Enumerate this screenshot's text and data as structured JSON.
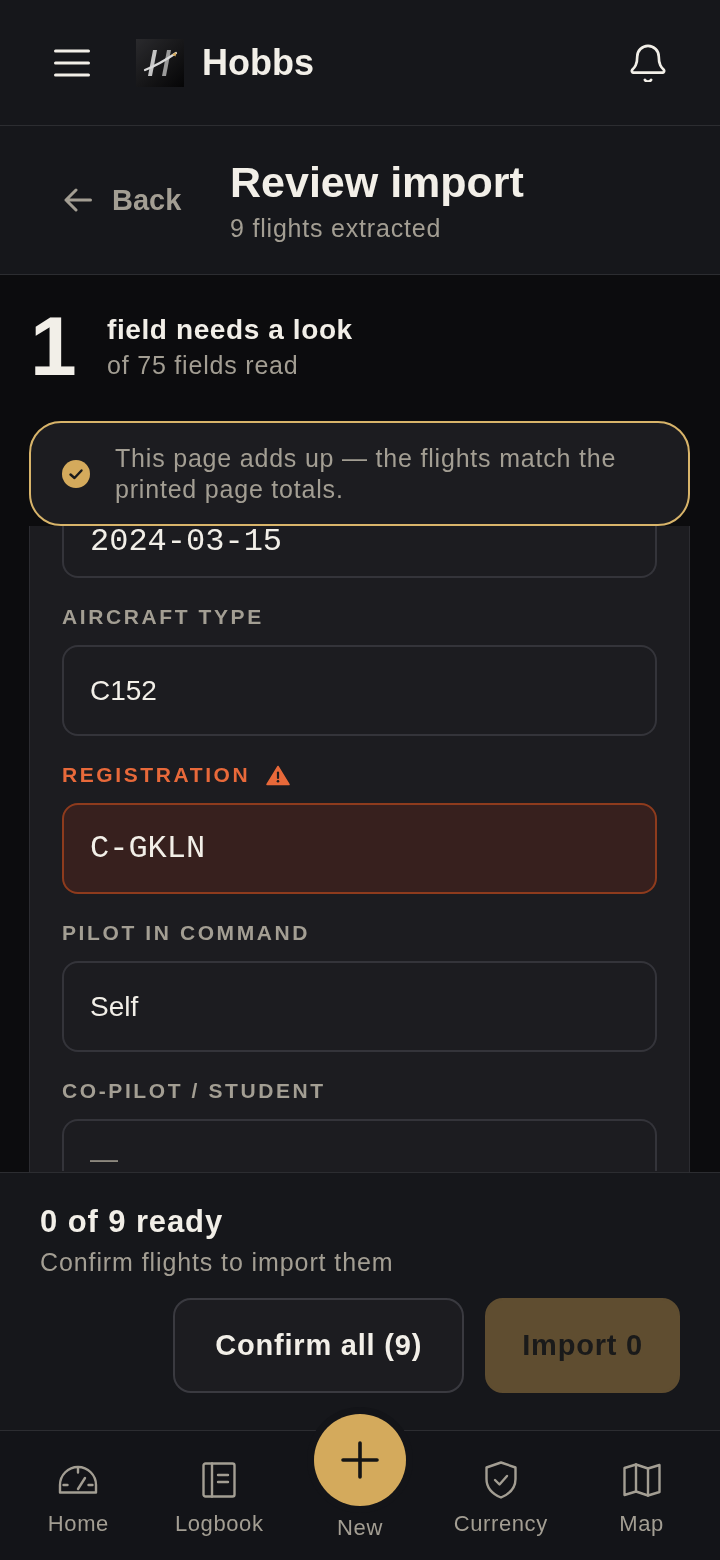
{
  "app_bar": {
    "title": "Hobbs"
  },
  "page_header": {
    "back_label": "Back",
    "title": "Review import",
    "subtitle": "9 flights extracted"
  },
  "summary": {
    "count": "1",
    "headline": "field needs a look",
    "detail": "of 75 fields read"
  },
  "banner": {
    "message": "This page adds up — the flights match the printed page totals."
  },
  "flight_card": {
    "fields": [
      {
        "value": "2024-03-15",
        "kind": "code",
        "flagged": false
      },
      {
        "label": "AIRCRAFT TYPE",
        "value": "C152",
        "kind": "text",
        "flagged": false
      },
      {
        "label": "REGISTRATION",
        "value": "C-GKLN",
        "kind": "code",
        "flagged": true
      },
      {
        "label": "PILOT IN COMMAND",
        "value": "Self",
        "kind": "text",
        "flagged": false
      },
      {
        "label": "CO-PILOT / STUDENT",
        "placeholder": "—",
        "kind": "text",
        "flagged": false
      }
    ]
  },
  "footer": {
    "status": "0 of 9 ready",
    "hint": "Confirm flights to import them",
    "buttons": [
      {
        "label": "Confirm all (9)",
        "kind": "secondary",
        "disabled": false
      },
      {
        "label": "Import 0",
        "kind": "primary",
        "disabled": true
      }
    ]
  },
  "tab_bar": {
    "items": [
      {
        "label": "Home",
        "kind": "tab",
        "selected": false
      },
      {
        "label": "Logbook",
        "kind": "tab",
        "selected": false
      },
      {
        "label": "New",
        "kind": "action",
        "selected": false
      },
      {
        "label": "Currency",
        "kind": "tab",
        "selected": false
      },
      {
        "label": "Map",
        "kind": "tab",
        "selected": false
      }
    ]
  }
}
